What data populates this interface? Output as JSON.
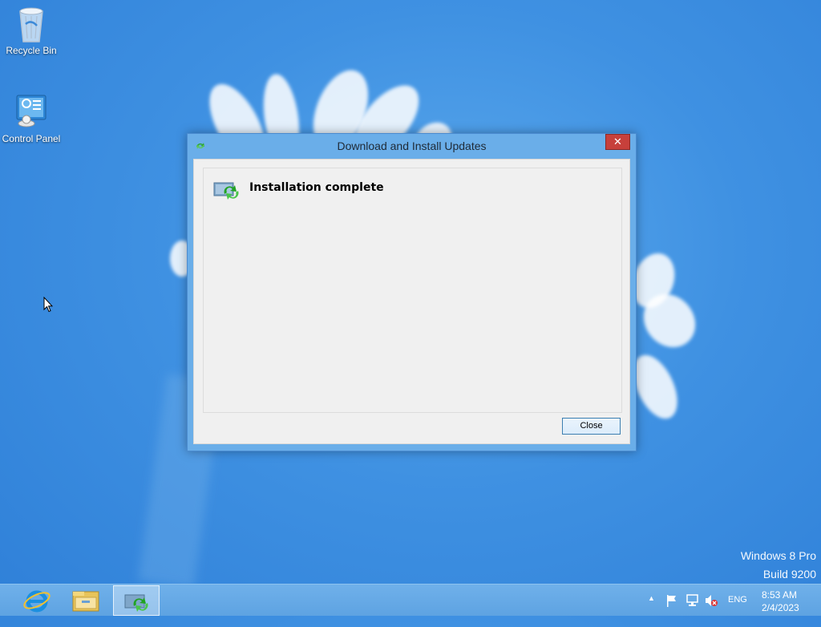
{
  "desktop": {
    "icons": [
      {
        "label": "Recycle Bin",
        "icon": "recycle-bin-icon"
      },
      {
        "label": "Control Panel",
        "icon": "control-panel-icon"
      }
    ],
    "watermark": {
      "line1": "Windows 8 Pro",
      "line2": "Build 9200"
    }
  },
  "dialog": {
    "title": "Download and Install Updates",
    "title_icon": "windows-update-icon",
    "close_glyph": "✕",
    "status_icon": "update-install-icon",
    "status_text": "Installation complete",
    "close_button_label": "Close"
  },
  "taskbar": {
    "apps": [
      {
        "name": "internet-explorer",
        "icon": "internet-explorer-icon",
        "active": false
      },
      {
        "name": "file-explorer",
        "icon": "file-explorer-icon",
        "active": false
      },
      {
        "name": "windows-update",
        "icon": "windows-update-icon",
        "active": true
      }
    ],
    "tray": {
      "show_hidden_glyph": "▲",
      "language": "ENG",
      "time": "8:53 AM",
      "date": "2/4/2023"
    }
  },
  "colors": {
    "desktop_bg": "#3f91e2",
    "dialog_frame": "#6aaee9",
    "close_red": "#c7403b",
    "taskbar": "#62a6e5"
  }
}
